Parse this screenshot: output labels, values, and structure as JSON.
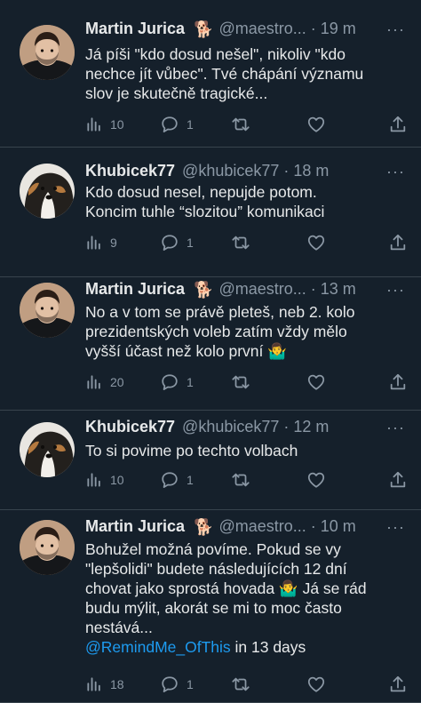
{
  "tweets": [
    {
      "author": "Martin Jurica",
      "badge_emoji": "🐕",
      "handle": "@maestro...",
      "time": "· 19 m",
      "lines": [
        "Já píši \"kdo dosud nešel\", nikoliv \"kdo",
        "nechce jít vůbec\". Tvé chápání významu",
        "slov je skutečně tragické..."
      ],
      "views": "10",
      "replies": "1"
    },
    {
      "author": "Khubicek77",
      "handle": "@khubicek77",
      "time": "· 18 m",
      "lines": [
        "Kdo dosud nesel, nepujde potom.",
        "Koncim tuhle “slozitou” komunikaci"
      ],
      "views": "9",
      "replies": "1"
    },
    {
      "author": "Martin Jurica",
      "badge_emoji": "🐕",
      "handle": "@maestro...",
      "time": "· 13 m",
      "lines": [
        "No a v tom se právě pleteš, neb 2. kolo",
        "prezidentských voleb zatím vždy mělo",
        "vyšší účast než kolo první 🤷‍♂️"
      ],
      "views": "20",
      "replies": "1"
    },
    {
      "author": "Khubicek77",
      "handle": "@khubicek77",
      "time": "· 12 m",
      "lines": [
        "To si povime po techto volbach"
      ],
      "views": "10",
      "replies": "1"
    },
    {
      "author": "Martin Jurica",
      "badge_emoji": "🐕",
      "handle": "@maestro...",
      "time": "· 10 m",
      "lines": [
        "Bohužel možná povíme. Pokud se vy",
        "\"lepšolidi\" budete následujících 12 dní",
        "chovat jako sprostá hovada 🤷‍♂️ Já se rád",
        "budu mýlit, akorát se mi to moc často",
        "nestává..."
      ],
      "mention": "@RemindMe_OfThis",
      "mention_tail": " in 13 days",
      "views": "18",
      "replies": "1"
    }
  ],
  "more_glyph": "···",
  "colors": {
    "background": "#15202b",
    "text": "#e7e9ea",
    "muted": "#8b98a5",
    "link": "#1d9bf0"
  },
  "icons": {
    "views": "bar-chart-icon",
    "reply": "reply-bubble-icon",
    "retweet": "retweet-icon",
    "like": "heart-icon",
    "share": "share-icon"
  }
}
